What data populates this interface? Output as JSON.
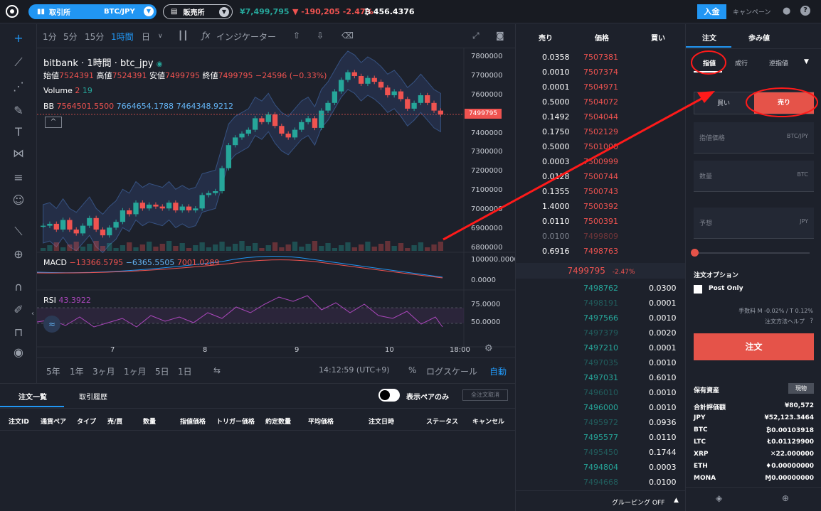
{
  "topbar": {
    "exchange_label": "取引所",
    "pair": "BTC/JPY",
    "sales_label": "販売所",
    "price": "¥7,499,795",
    "change": "-190,205 -2.47%",
    "balance": "456.4376",
    "deposit_label": "入金",
    "campaign_label": "キャンペーン"
  },
  "chart_toolbar": {
    "intervals": [
      "1分",
      "5分",
      "15分",
      "1時間",
      "日"
    ],
    "indicator_label": "インジケーター"
  },
  "chart_info": {
    "title": "bitbank · 1時間 · btc_jpy",
    "open_label": "始値",
    "open": "7524391",
    "high_label": "高値",
    "high": "7524391",
    "low_label": "安値",
    "low": "7499795",
    "close_label": "終値",
    "close": "7499795",
    "change": "−24596 (−0.33%)",
    "volume_label": "Volume",
    "volume_a": "2",
    "volume_b": "19",
    "bb_label": "BB",
    "bb1": "7564501.5500",
    "bb2": "7664654.1788",
    "bb3": "7464348.9212",
    "macd_label": "MACD",
    "macd1": "−13366.5795",
    "macd2": "−6365.5505",
    "macd3": "7001.0289",
    "rsi_label": "RSI",
    "rsi": "43.3922",
    "price_tag": "7499795"
  },
  "chart_data": {
    "type": "candlestick",
    "y_ticks": [
      "7800000",
      "7700000",
      "7600000",
      "7500000",
      "7400000",
      "7300000",
      "7200000",
      "7100000",
      "7000000",
      "6900000",
      "6800000"
    ],
    "macd_ticks": [
      "100000.0000",
      "0.0000"
    ],
    "rsi_ticks": [
      "75.0000",
      "50.0000"
    ],
    "x_ticks": [
      "7",
      "8",
      "9",
      "10",
      "18:00"
    ],
    "close": [
      6920000,
      6930000,
      6900000,
      6950000,
      6900000,
      6880000,
      6920000,
      6960000,
      6900000,
      6870000,
      6910000,
      6940000,
      7000000,
      6980000,
      7040000,
      7010000,
      7030000,
      7020000,
      7010000,
      7040000,
      7000000,
      7020000,
      7000000,
      7010000,
      7080000,
      7090000,
      7100000,
      7220000,
      7340000,
      7380000,
      7400000,
      7420000,
      7480000,
      7460000,
      7500000,
      7440000,
      7400000,
      7380000,
      7420000,
      7460000,
      7480000,
      7430000,
      7520000,
      7560000,
      7620000,
      7680000,
      7720000,
      7700000,
      7660000,
      7690000,
      7670000,
      7640000,
      7600000,
      7620000,
      7580000,
      7530000,
      7560000,
      7600000,
      7560000,
      7520000,
      7499795
    ]
  },
  "bottom_toolbar": {
    "ranges": [
      "5年",
      "1年",
      "3ヶ月",
      "1ヶ月",
      "5日",
      "1日"
    ],
    "time": "14:12:59 (UTC+9)",
    "percent": "%",
    "log_label": "ログスケール",
    "auto_label": "自動"
  },
  "orders": {
    "tab_orders": "注文一覧",
    "tab_history": "取引履歴",
    "pair_only": "表示ペアのみ",
    "cancel_all": "全注文取消",
    "columns": [
      "注文ID",
      "通貨ペア",
      "タイプ",
      "売/買",
      "数量",
      "指値価格",
      "トリガー価格",
      "約定数量",
      "平均価格",
      "注文日時",
      "ステータス",
      "キャンセル"
    ]
  },
  "book": {
    "sell_label": "売り",
    "price_label": "価格",
    "buy_label": "買い",
    "asks": [
      [
        "0.0358",
        "7507381"
      ],
      [
        "0.0010",
        "7507374"
      ],
      [
        "0.0001",
        "7504971"
      ],
      [
        "0.5000",
        "7504072"
      ],
      [
        "0.1492",
        "7504044"
      ],
      [
        "0.1750",
        "7502129"
      ],
      [
        "0.5000",
        "7501000"
      ],
      [
        "0.0003",
        "7500999"
      ],
      [
        "0.0128",
        "7500744"
      ],
      [
        "0.1355",
        "7500743"
      ],
      [
        "1.4000",
        "7500392"
      ],
      [
        "0.0110",
        "7500391"
      ],
      [
        "0.0100",
        "7499809"
      ],
      [
        "0.6916",
        "7498763"
      ]
    ],
    "mid": "7499795",
    "mid_change": "-2.47%",
    "bids": [
      [
        "7498762",
        "0.0300"
      ],
      [
        "7498191",
        "0.0001"
      ],
      [
        "7497566",
        "0.0010"
      ],
      [
        "7497379",
        "0.0020"
      ],
      [
        "7497210",
        "0.0001"
      ],
      [
        "7497035",
        "0.0010"
      ],
      [
        "7497031",
        "0.6010"
      ],
      [
        "7496010",
        "0.0010"
      ],
      [
        "7496000",
        "0.0010"
      ],
      [
        "7495972",
        "0.0936"
      ],
      [
        "7495577",
        "0.0110"
      ],
      [
        "7495450",
        "0.1744"
      ],
      [
        "7494804",
        "0.0003"
      ],
      [
        "7494668",
        "0.0100"
      ]
    ],
    "grouping": "グルーピング OFF"
  },
  "form": {
    "tab_order": "注文",
    "tab_trades": "歩み値",
    "type_limit": "指値",
    "type_market": "成行",
    "type_stop": "逆指値",
    "buy": "買い",
    "sell": "売り",
    "price_label": "指値価格",
    "price_unit": "BTC/JPY",
    "qty_label": "数量",
    "qty_unit": "BTC",
    "est_label": "予想",
    "est_unit": "JPY",
    "options_label": "注文オプション",
    "post_only": "Post Only",
    "fee": "手数料 M -0.02% / T 0.12%",
    "help": "注文方法ヘルプ",
    "submit": "注文",
    "assets_label": "保有資産",
    "spot": "現物",
    "assets": [
      [
        "合計評価額",
        "¥80,572"
      ],
      [
        "JPY",
        "¥52,123.3464"
      ],
      [
        "BTC",
        "₿0.00103918"
      ],
      [
        "LTC",
        "Ł0.01129900"
      ],
      [
        "XRP",
        "✕22.000000"
      ],
      [
        "ETH",
        "♦0.00000000"
      ],
      [
        "MONA",
        "Ɱ0.00000000"
      ]
    ]
  }
}
